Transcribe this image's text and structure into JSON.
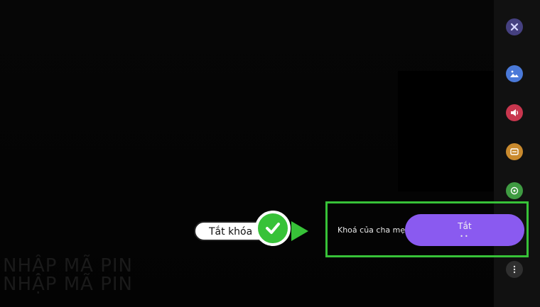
{
  "background": {
    "ghost_text_1": "NHẬP MÃ PIN",
    "ghost_text_2": "NHẬP MÃ PIN"
  },
  "sidebar": {
    "icons": [
      {
        "name": "close-icon",
        "color": "#454080"
      },
      {
        "name": "picture-icon",
        "color": "#4a79d8"
      },
      {
        "name": "sound-icon",
        "color": "#c8364e"
      },
      {
        "name": "general-icon",
        "color": "#c98a2e"
      },
      {
        "name": "support-icon",
        "color": "#3f9b42"
      },
      {
        "name": "more-options-icon",
        "color": "#2f2f2f"
      }
    ]
  },
  "setting": {
    "label": "Khoá của cha mẹ",
    "value": "Tắt",
    "dots": "••",
    "accent": "#8a5af0"
  },
  "callout": {
    "text": "Tắt khóa",
    "accent": "#37c238"
  }
}
